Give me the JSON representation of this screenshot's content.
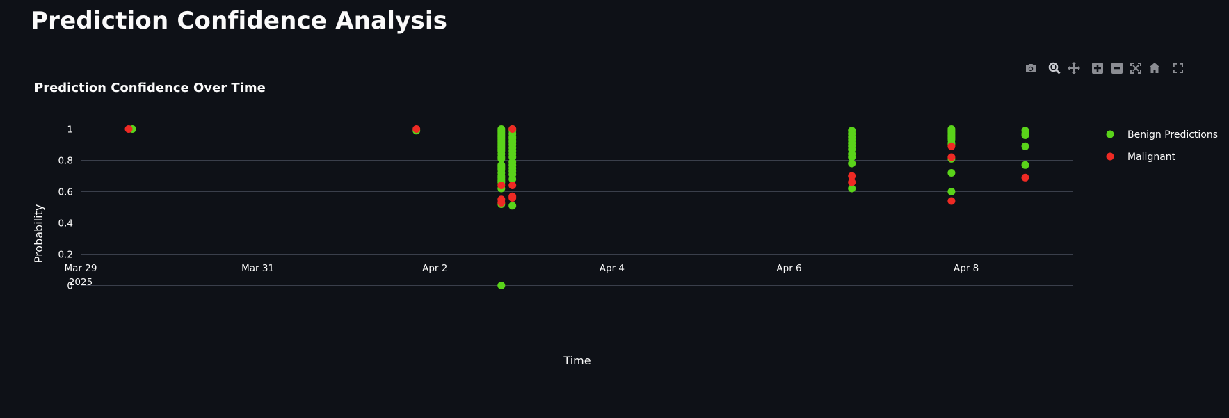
{
  "page": {
    "title": "Prediction Confidence Analysis"
  },
  "modebar": {
    "icons": [
      "camera-icon",
      "zoom-icon",
      "pan-icon",
      "zoom-in-icon",
      "zoom-out-icon",
      "autoscale-icon",
      "reset-axes-icon",
      "fullscreen-icon"
    ]
  },
  "colors": {
    "background": "#0e1117",
    "grid": "#3a3f4b",
    "benign": "#5ad31a",
    "malignant": "#ee2a24",
    "text": "#fafafa"
  },
  "chart_data": {
    "type": "scatter",
    "title": "Prediction Confidence Over Time",
    "xlabel": "Time",
    "ylabel": "Probability",
    "xlim": [
      "2025-03-29",
      "2025-04-09T05:00"
    ],
    "ylim": [
      -0.1,
      1.1
    ],
    "x_ticks": [
      {
        "date": "2025-03-29",
        "label": "Mar 29",
        "sublabel": "2025"
      },
      {
        "date": "2025-03-31",
        "label": "Mar 31"
      },
      {
        "date": "2025-04-02",
        "label": "Apr 2"
      },
      {
        "date": "2025-04-04",
        "label": "Apr 4"
      },
      {
        "date": "2025-04-06",
        "label": "Apr 6"
      },
      {
        "date": "2025-04-08",
        "label": "Apr 8"
      }
    ],
    "y_ticks": [
      {
        "value": 0,
        "label": "0"
      },
      {
        "value": 0.2,
        "label": "0.2"
      },
      {
        "value": 0.4,
        "label": "0.4"
      },
      {
        "value": 0.6,
        "label": "0.6"
      },
      {
        "value": 0.8,
        "label": "0.8"
      },
      {
        "value": 1,
        "label": "1"
      }
    ],
    "grid": true,
    "legend_position": "right",
    "series": [
      {
        "name": "Benign Predictions",
        "color": "#5ad31a",
        "points": [
          {
            "x": "2025-03-29T14:00",
            "y": 1.0
          },
          {
            "x": "2025-04-01T19:00",
            "y": 0.99
          },
          {
            "x": "2025-04-02T18:00",
            "y": 1.0
          },
          {
            "x": "2025-04-02T18:00",
            "y": 0.99
          },
          {
            "x": "2025-04-02T18:00",
            "y": 0.98
          },
          {
            "x": "2025-04-02T18:00",
            "y": 0.97
          },
          {
            "x": "2025-04-02T18:00",
            "y": 0.96
          },
          {
            "x": "2025-04-02T18:00",
            "y": 0.95
          },
          {
            "x": "2025-04-02T18:00",
            "y": 0.94
          },
          {
            "x": "2025-04-02T18:00",
            "y": 0.93
          },
          {
            "x": "2025-04-02T18:00",
            "y": 0.92
          },
          {
            "x": "2025-04-02T18:00",
            "y": 0.91
          },
          {
            "x": "2025-04-02T18:00",
            "y": 0.9
          },
          {
            "x": "2025-04-02T18:00",
            "y": 0.89
          },
          {
            "x": "2025-04-02T18:00",
            "y": 0.88
          },
          {
            "x": "2025-04-02T18:00",
            "y": 0.87
          },
          {
            "x": "2025-04-02T18:00",
            "y": 0.86
          },
          {
            "x": "2025-04-02T18:00",
            "y": 0.84
          },
          {
            "x": "2025-04-02T18:00",
            "y": 0.82
          },
          {
            "x": "2025-04-02T18:00",
            "y": 0.81
          },
          {
            "x": "2025-04-02T18:00",
            "y": 0.77
          },
          {
            "x": "2025-04-02T18:00",
            "y": 0.76
          },
          {
            "x": "2025-04-02T18:00",
            "y": 0.75
          },
          {
            "x": "2025-04-02T18:00",
            "y": 0.74
          },
          {
            "x": "2025-04-02T18:00",
            "y": 0.72
          },
          {
            "x": "2025-04-02T18:00",
            "y": 0.7
          },
          {
            "x": "2025-04-02T18:00",
            "y": 0.69
          },
          {
            "x": "2025-04-02T18:00",
            "y": 0.68
          },
          {
            "x": "2025-04-02T18:00",
            "y": 0.67
          },
          {
            "x": "2025-04-02T18:00",
            "y": 0.66
          },
          {
            "x": "2025-04-02T18:00",
            "y": 0.62
          },
          {
            "x": "2025-04-02T18:00",
            "y": 0.52
          },
          {
            "x": "2025-04-02T18:00",
            "y": 0.0
          },
          {
            "x": "2025-04-02T21:00",
            "y": 1.0
          },
          {
            "x": "2025-04-02T21:00",
            "y": 0.99
          },
          {
            "x": "2025-04-02T21:00",
            "y": 0.97
          },
          {
            "x": "2025-04-02T21:00",
            "y": 0.95
          },
          {
            "x": "2025-04-02T21:00",
            "y": 0.94
          },
          {
            "x": "2025-04-02T21:00",
            "y": 0.92
          },
          {
            "x": "2025-04-02T21:00",
            "y": 0.9
          },
          {
            "x": "2025-04-02T21:00",
            "y": 0.88
          },
          {
            "x": "2025-04-02T21:00",
            "y": 0.86
          },
          {
            "x": "2025-04-02T21:00",
            "y": 0.84
          },
          {
            "x": "2025-04-02T21:00",
            "y": 0.82
          },
          {
            "x": "2025-04-02T21:00",
            "y": 0.79
          },
          {
            "x": "2025-04-02T21:00",
            "y": 0.77
          },
          {
            "x": "2025-04-02T21:00",
            "y": 0.75
          },
          {
            "x": "2025-04-02T21:00",
            "y": 0.73
          },
          {
            "x": "2025-04-02T21:00",
            "y": 0.71
          },
          {
            "x": "2025-04-02T21:00",
            "y": 0.68
          },
          {
            "x": "2025-04-02T21:00",
            "y": 0.51
          },
          {
            "x": "2025-04-06T17:00",
            "y": 0.99
          },
          {
            "x": "2025-04-06T17:00",
            "y": 0.97
          },
          {
            "x": "2025-04-06T17:00",
            "y": 0.95
          },
          {
            "x": "2025-04-06T17:00",
            "y": 0.93
          },
          {
            "x": "2025-04-06T17:00",
            "y": 0.91
          },
          {
            "x": "2025-04-06T17:00",
            "y": 0.89
          },
          {
            "x": "2025-04-06T17:00",
            "y": 0.87
          },
          {
            "x": "2025-04-06T17:00",
            "y": 0.84
          },
          {
            "x": "2025-04-06T17:00",
            "y": 0.82
          },
          {
            "x": "2025-04-06T17:00",
            "y": 0.78
          },
          {
            "x": "2025-04-06T17:00",
            "y": 0.62
          },
          {
            "x": "2025-04-07T20:00",
            "y": 1.0
          },
          {
            "x": "2025-04-07T20:00",
            "y": 0.99
          },
          {
            "x": "2025-04-07T20:00",
            "y": 0.98
          },
          {
            "x": "2025-04-07T20:00",
            "y": 0.97
          },
          {
            "x": "2025-04-07T20:00",
            "y": 0.96
          },
          {
            "x": "2025-04-07T20:00",
            "y": 0.95
          },
          {
            "x": "2025-04-07T20:00",
            "y": 0.94
          },
          {
            "x": "2025-04-07T20:00",
            "y": 0.93
          },
          {
            "x": "2025-04-07T20:00",
            "y": 0.91
          },
          {
            "x": "2025-04-07T20:00",
            "y": 0.9
          },
          {
            "x": "2025-04-07T20:00",
            "y": 0.81
          },
          {
            "x": "2025-04-07T20:00",
            "y": 0.72
          },
          {
            "x": "2025-04-07T20:00",
            "y": 0.6
          },
          {
            "x": "2025-04-08T16:00",
            "y": 0.99
          },
          {
            "x": "2025-04-08T16:00",
            "y": 0.97
          },
          {
            "x": "2025-04-08T16:00",
            "y": 0.96
          },
          {
            "x": "2025-04-08T16:00",
            "y": 0.89
          },
          {
            "x": "2025-04-08T16:00",
            "y": 0.77
          }
        ]
      },
      {
        "name": "Malignant",
        "color": "#ee2a24",
        "points": [
          {
            "x": "2025-03-29T13:00",
            "y": 1.0
          },
          {
            "x": "2025-04-01T19:00",
            "y": 1.0
          },
          {
            "x": "2025-04-02T18:00",
            "y": 0.64
          },
          {
            "x": "2025-04-02T18:00",
            "y": 0.55
          },
          {
            "x": "2025-04-02T18:00",
            "y": 0.53
          },
          {
            "x": "2025-04-02T21:00",
            "y": 1.0
          },
          {
            "x": "2025-04-02T21:00",
            "y": 0.64
          },
          {
            "x": "2025-04-02T21:00",
            "y": 0.57
          },
          {
            "x": "2025-04-02T21:00",
            "y": 0.56
          },
          {
            "x": "2025-04-06T17:00",
            "y": 0.7
          },
          {
            "x": "2025-04-06T17:00",
            "y": 0.66
          },
          {
            "x": "2025-04-07T20:00",
            "y": 0.89
          },
          {
            "x": "2025-04-07T20:00",
            "y": 0.82
          },
          {
            "x": "2025-04-07T20:00",
            "y": 0.54
          },
          {
            "x": "2025-04-08T16:00",
            "y": 0.69
          }
        ]
      }
    ]
  }
}
